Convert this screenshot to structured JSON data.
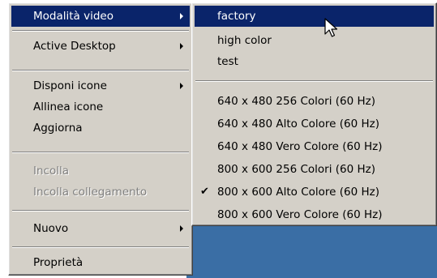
{
  "main_menu": {
    "items": [
      {
        "label": "Modalità video"
      },
      {
        "label": "Active Desktop"
      },
      {
        "label": "Disponi icone"
      },
      {
        "label": "Allinea icone"
      },
      {
        "label": "Aggiorna"
      },
      {
        "label": "Incolla"
      },
      {
        "label": "Incolla collegamento"
      },
      {
        "label": "Nuovo"
      },
      {
        "label": "Proprietà"
      }
    ]
  },
  "video_submenu": {
    "items": [
      {
        "label": "factory"
      },
      {
        "label": "high color"
      },
      {
        "label": "test"
      },
      {
        "label": "640 x 480 256 Colori (60 Hz)"
      },
      {
        "label": "640 x 480 Alto Colore (60 Hz)"
      },
      {
        "label": "640 x 480 Vero Colore (60 Hz)"
      },
      {
        "label": "800 x 600 256 Colori (60 Hz)"
      },
      {
        "label": "800 x 600 Alto Colore (60 Hz)"
      },
      {
        "label": "800 x 600 Vero Colore (60 Hz)"
      }
    ],
    "checked_item": "800 x 600 Alto Colore (60 Hz)"
  },
  "colors": {
    "menu_bg": "#d4d0c8",
    "highlight": "#0a246a",
    "desktop": "#3a6ea5"
  },
  "icons": {
    "submenu_arrow": "submenu-arrow-icon",
    "checkmark": "check-icon",
    "cursor": "mouse-pointer-icon"
  }
}
